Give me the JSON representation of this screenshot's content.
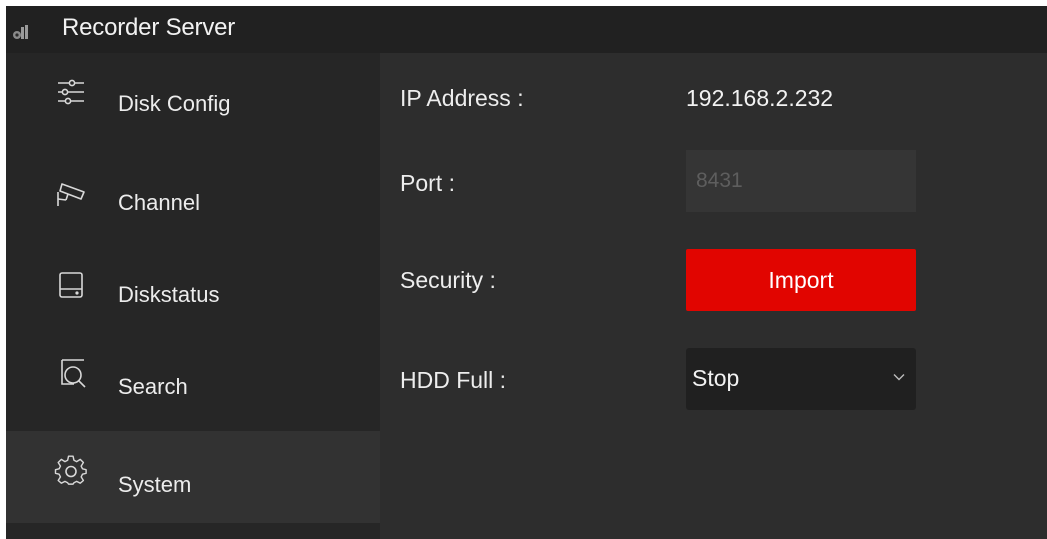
{
  "window": {
    "title": "Recorder Server"
  },
  "sidebar": {
    "items": [
      {
        "label": "Disk Config",
        "icon": "sliders-icon"
      },
      {
        "label": "Channel",
        "icon": "camera-icon"
      },
      {
        "label": "Diskstatus",
        "icon": "disk-icon"
      },
      {
        "label": "Search",
        "icon": "search-icon"
      },
      {
        "label": "System",
        "icon": "gear-icon",
        "active": true
      }
    ]
  },
  "system": {
    "ip_label": "IP Address :",
    "ip_value": "192.168.2.232",
    "port_label": "Port :",
    "port_value": "8431",
    "security_label": "Security :",
    "import_label": "Import",
    "hdd_full_label": "HDD Full :",
    "hdd_full_value": "Stop"
  },
  "colors": {
    "accent": "#e10500",
    "background": "#2d2d2d",
    "sidebar": "#262626",
    "titlebar": "#212121"
  }
}
